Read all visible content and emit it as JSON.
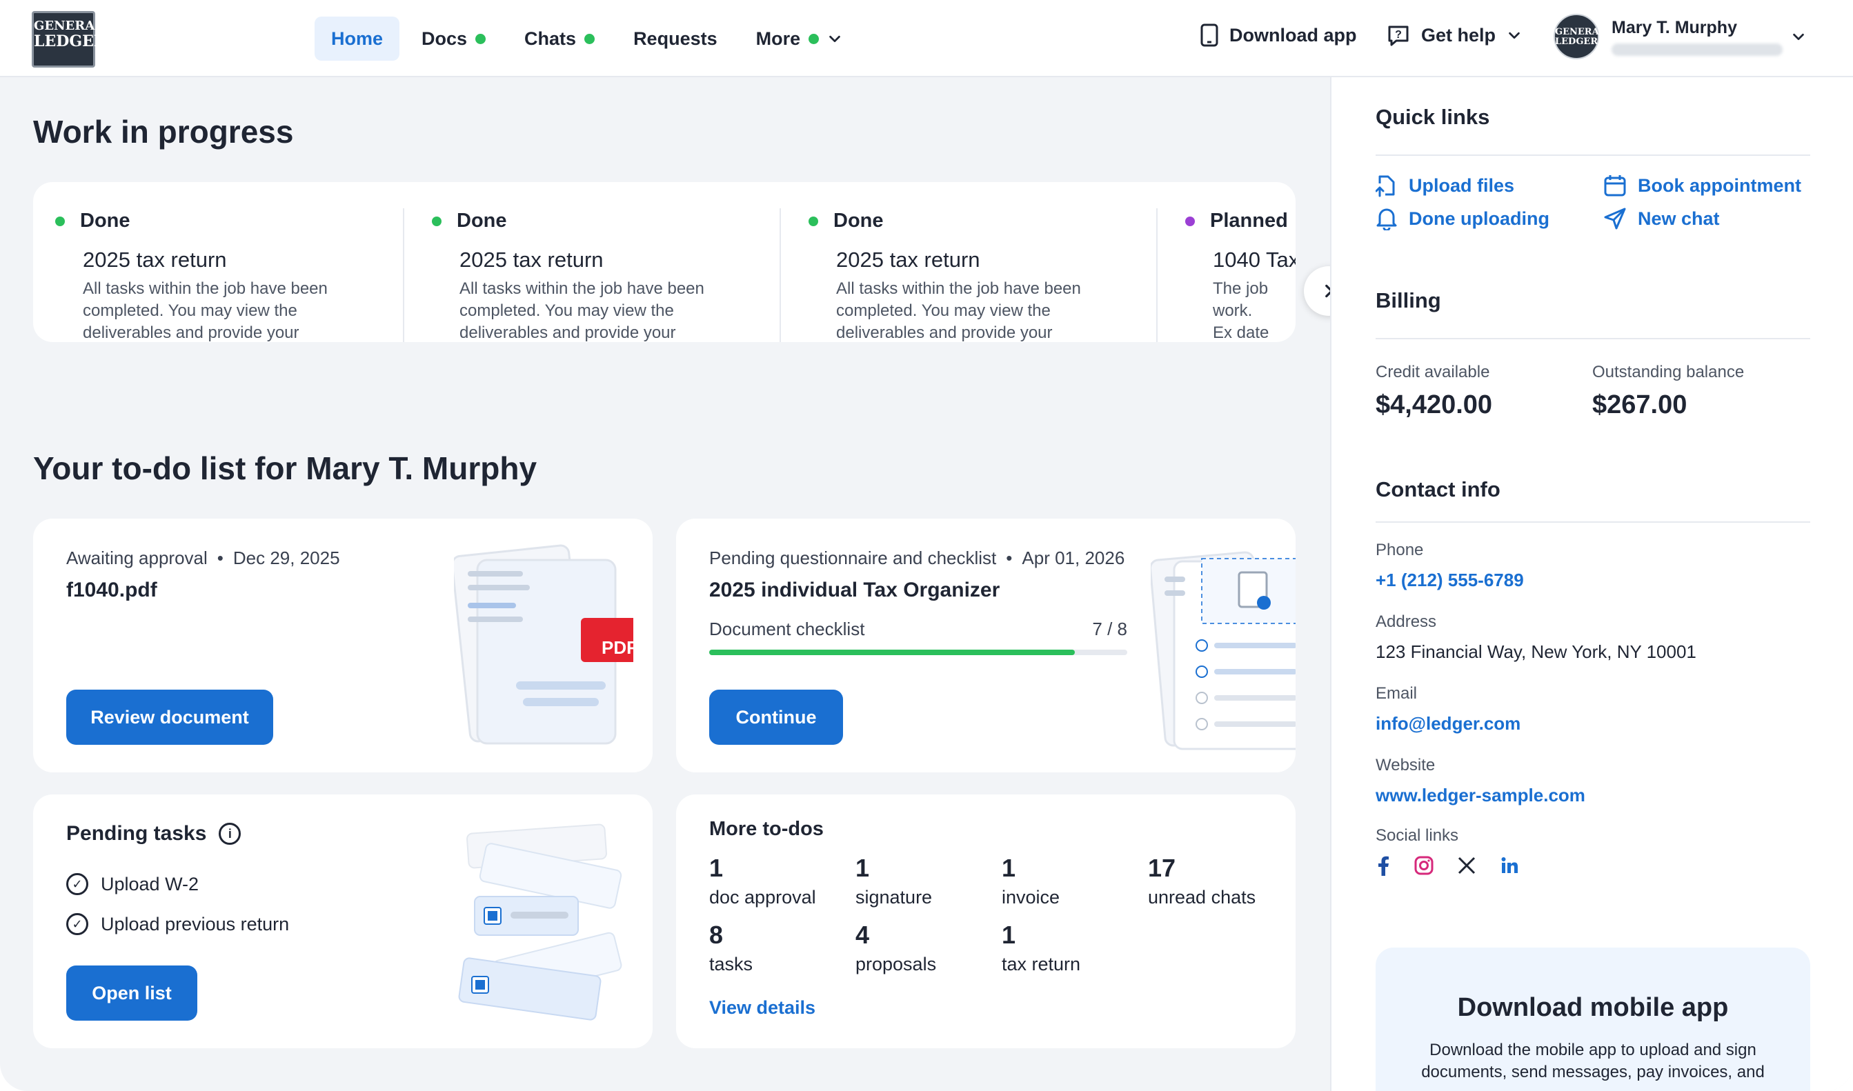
{
  "header": {
    "logo": {
      "line1": "GENERAL",
      "line2": "LEDGER"
    },
    "nav": [
      {
        "label": "Home",
        "active": true,
        "dot": false,
        "chevron": false
      },
      {
        "label": "Docs",
        "active": false,
        "dot": true,
        "chevron": false
      },
      {
        "label": "Chats",
        "active": false,
        "dot": true,
        "chevron": false
      },
      {
        "label": "Requests",
        "active": false,
        "dot": false,
        "chevron": false
      },
      {
        "label": "More",
        "active": false,
        "dot": true,
        "chevron": true
      }
    ],
    "download_app": "Download app",
    "get_help": "Get help",
    "user": {
      "name": "Mary T. Murphy"
    }
  },
  "main": {
    "wip_title": "Work in progress",
    "wip_items": [
      {
        "status": "Done",
        "status_color": "#2bbf5b",
        "title": "2025 tax return",
        "desc": "All tasks within the job have been completed. You may view the deliverables and provide your feedback."
      },
      {
        "status": "Done",
        "status_color": "#2bbf5b",
        "title": "2025 tax return",
        "desc": "All tasks within the job have been completed. You may view the deliverables and provide your feedback."
      },
      {
        "status": "Done",
        "status_color": "#2bbf5b",
        "title": "2025 tax return",
        "desc": "All tasks within the job have been completed. You may view the deliverables and provide your feedback."
      },
      {
        "status": "Planned",
        "status_color": "#9b3fd4",
        "title": "1040 Tax",
        "desc": "The job work. Ex date and"
      }
    ],
    "todo_title": "Your to-do list for Mary T. Murphy",
    "approval": {
      "status": "Awaiting approval",
      "date": "Dec 29, 2025",
      "file": "f1040.pdf",
      "button": "Review document",
      "pdf_label": "PDF"
    },
    "organizer": {
      "status": "Pending questionnaire and checklist",
      "date": "Apr 01, 2026",
      "title": "2025 individual Tax Organizer",
      "checklist_label": "Document checklist",
      "checklist_count": "7 / 8",
      "progress": 0.875,
      "button": "Continue"
    },
    "pending": {
      "title": "Pending tasks",
      "items": [
        "Upload W-2",
        "Upload previous return"
      ],
      "button": "Open list"
    },
    "more": {
      "title": "More to-dos",
      "stats": [
        {
          "num": "1",
          "label": "doc approval"
        },
        {
          "num": "1",
          "label": "signature"
        },
        {
          "num": "1",
          "label": "invoice"
        },
        {
          "num": "17",
          "label": "unread chats"
        },
        {
          "num": "8",
          "label": "tasks"
        },
        {
          "num": "4",
          "label": "proposals"
        },
        {
          "num": "1",
          "label": "tax return"
        }
      ],
      "link": "View details"
    }
  },
  "side": {
    "quick_links_title": "Quick links",
    "quick_links": [
      {
        "label": "Upload files",
        "icon": "upload-file-icon"
      },
      {
        "label": "Book appointment",
        "icon": "calendar-icon"
      },
      {
        "label": "Done uploading",
        "icon": "bell-icon"
      },
      {
        "label": "New chat",
        "icon": "send-icon"
      }
    ],
    "billing_title": "Billing",
    "credit_label": "Credit available",
    "credit_value": "$4,420.00",
    "balance_label": "Outstanding balance",
    "balance_value": "$267.00",
    "contact_title": "Contact info",
    "phone_label": "Phone",
    "phone_value": "+1 (212) 555-6789",
    "address_label": "Address",
    "address_value": "123 Financial Way, New York, NY 10001",
    "email_label": "Email",
    "email_value": "info@ledger.com",
    "website_label": "Website",
    "website_value": "www.ledger-sample.com",
    "social_label": "Social links",
    "mobile_title": "Download mobile app",
    "mobile_desc": "Download the mobile app to upload and sign documents, send messages, pay invoices, and"
  },
  "colors": {
    "accent": "#1a6fd1",
    "green": "#2bbf5b",
    "purple": "#9b3fd4",
    "pdf_red": "#e5232f"
  }
}
